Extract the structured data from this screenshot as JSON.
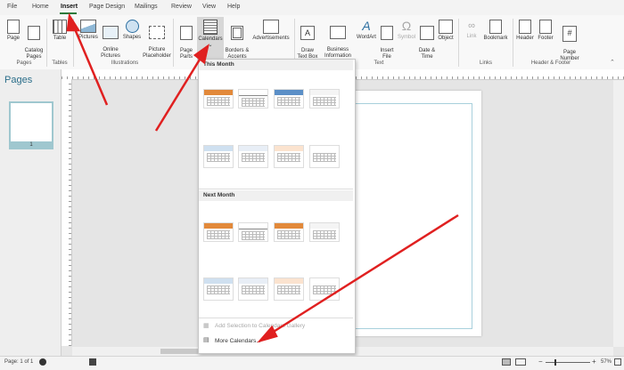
{
  "menu": {
    "file": "File",
    "home": "Home",
    "insert": "Insert",
    "page_design": "Page Design",
    "mailings": "Mailings",
    "review": "Review",
    "view": "View",
    "help": "Help"
  },
  "ribbon": {
    "page": "Page",
    "catalog_pages": "Catalog\nPages",
    "table": "Table",
    "pictures": "Pictures",
    "online_pictures": "Online\nPictures",
    "shapes": "Shapes",
    "picture_placeholder": "Picture\nPlaceholder",
    "page_parts": "Page\nParts",
    "calendars": "Calendars",
    "borders_accents": "Borders &\nAccents",
    "advertisements": "Advertisements",
    "draw_text_box": "Draw\nText Box",
    "business_information": "Business\nInformation",
    "wordart": "WordArt",
    "insert_file": "Insert\nFile",
    "symbol": "Symbol",
    "date_time": "Date &\nTime",
    "object": "Object",
    "link": "Link",
    "bookmark": "Bookmark",
    "header": "Header",
    "footer": "Footer",
    "page_number": "Page\nNumber",
    "groups": {
      "pages": "Pages",
      "tables": "Tables",
      "illustrations": "Illustrations",
      "text": "Text",
      "links": "Links",
      "header_footer": "Header & Footer"
    }
  },
  "pages_pane": {
    "title": "Pages",
    "thumb_number": "1"
  },
  "calendars_dropdown": {
    "this_month": "This Month",
    "next_month": "Next Month",
    "add_selection": "Add Selection to Calendars Gallery",
    "more_calendars": "More Calendars..."
  },
  "status": {
    "page_info": "Page: 1 of 1",
    "zoom": "57%"
  },
  "colors": {
    "accent_green": "#2b7a3b",
    "arrow_red": "#e02020",
    "calendar_orange": "#e2893a",
    "calendar_blue": "#5b8fc7"
  }
}
